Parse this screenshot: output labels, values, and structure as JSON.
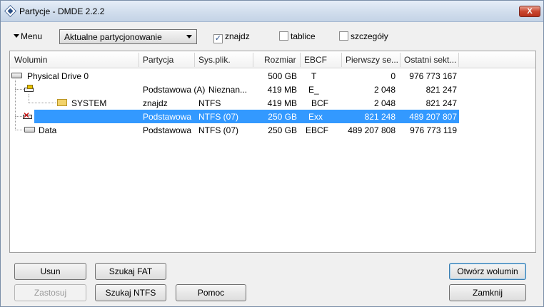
{
  "window": {
    "title": "Partycje - DMDE 2.2.2",
    "close_label": "X"
  },
  "toolbar": {
    "menu_label": "Menu",
    "mode_select": "Aktualne partycjonowanie",
    "checks": [
      {
        "label": "znajdz",
        "checked": true
      },
      {
        "label": "tablice",
        "checked": false
      },
      {
        "label": "szczegóły",
        "checked": false
      }
    ]
  },
  "columns": [
    "Wolumin",
    "Partycja",
    "Sys.plik.",
    "Rozmiar",
    "EBCF",
    "Pierwszy se...",
    "Ostatni sekt..."
  ],
  "rows": [
    {
      "wolumin": "Physical Drive 0",
      "partycja": "",
      "sys": "",
      "rozmiar": "500 GB",
      "ebcf": "T",
      "first": "0",
      "last": "976 773 167"
    },
    {
      "wolumin": "",
      "partycja": "Podstawowa (A)",
      "sys": "Nieznan...",
      "rozmiar": "419 MB",
      "ebcf": "E_",
      "first": "2 048",
      "last": "821 247"
    },
    {
      "wolumin": "SYSTEM",
      "partycja": "znajdz",
      "sys": "NTFS",
      "rozmiar": "419 MB",
      "ebcf": "BCF",
      "first": "2 048",
      "last": "821 247"
    },
    {
      "wolumin": "",
      "partycja": "Podstawowa",
      "sys": "NTFS (07)",
      "rozmiar": "250 GB",
      "ebcf": "Exx",
      "first": "821 248",
      "last": "489 207 807"
    },
    {
      "wolumin": "Data",
      "partycja": "Podstawowa",
      "sys": "NTFS (07)",
      "rozmiar": "250 GB",
      "ebcf": "EBCF",
      "first": "489 207 808",
      "last": "976 773 119"
    }
  ],
  "buttons": {
    "usun": "Usun",
    "szukaj_fat": "Szukaj FAT",
    "zastosuj": "Zastosuj",
    "szukaj_ntfs": "Szukaj NTFS",
    "pomoc": "Pomoc",
    "otworz": "Otwórz wolumin",
    "zamknij": "Zamknij"
  }
}
